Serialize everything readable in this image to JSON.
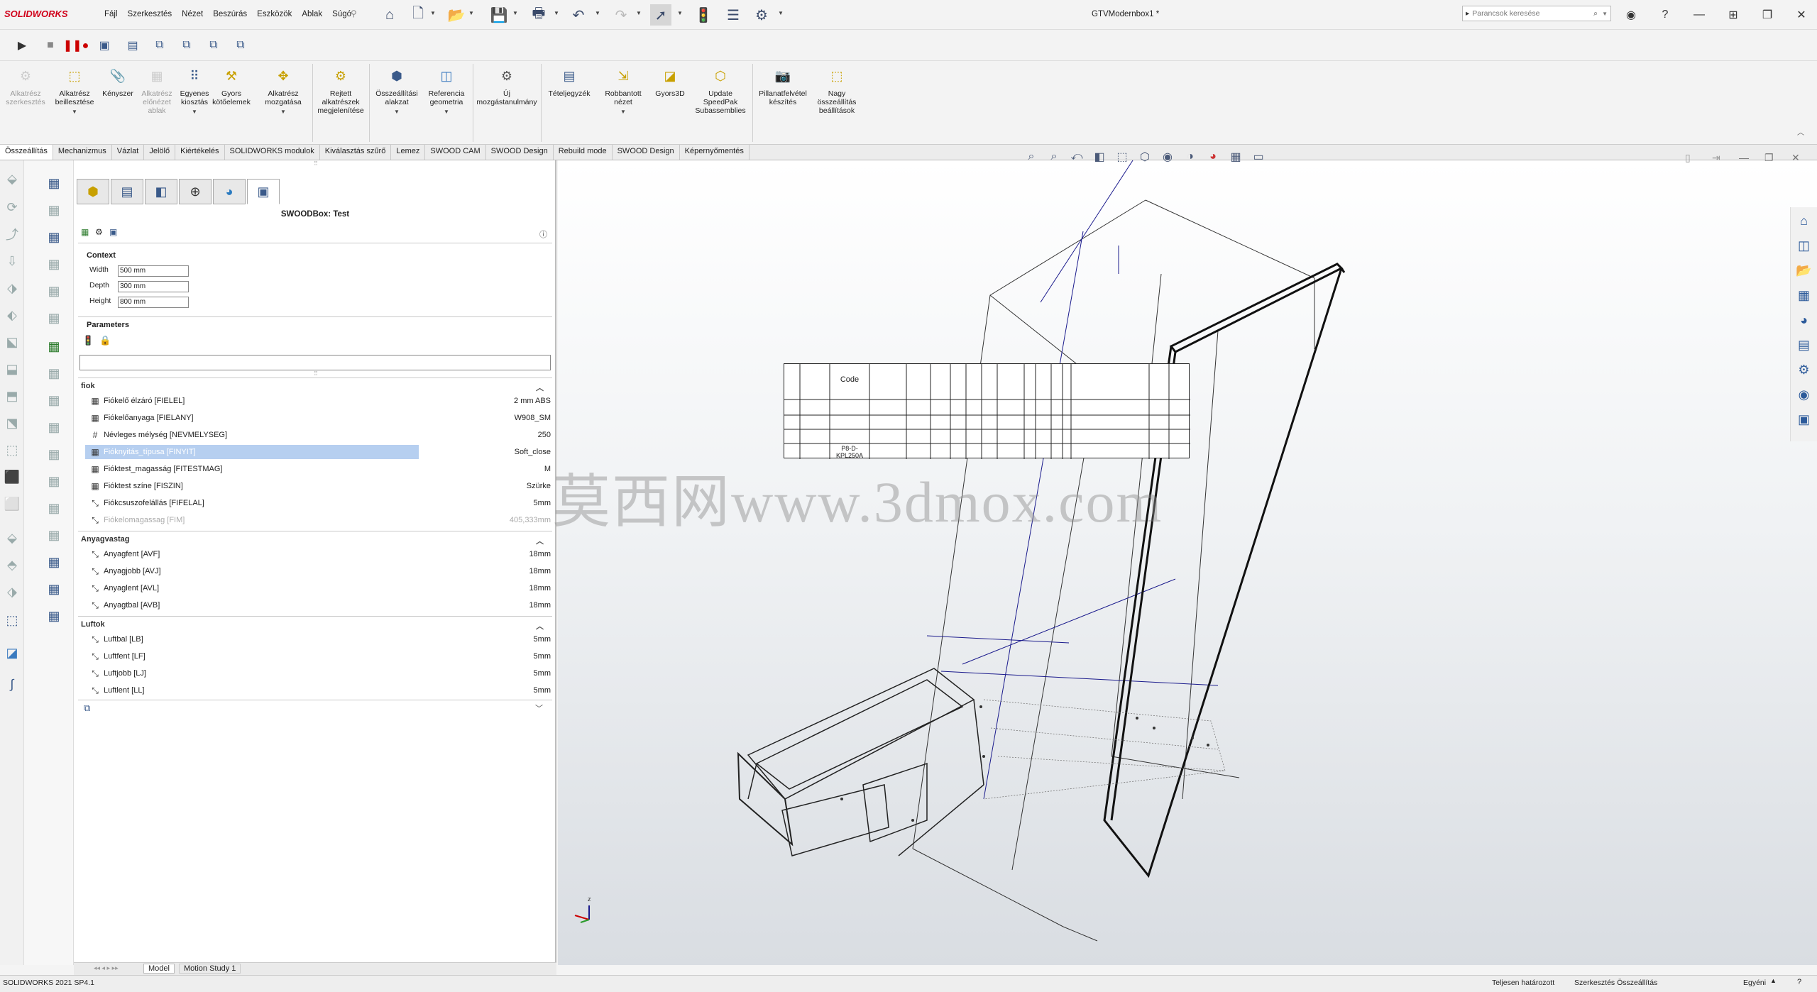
{
  "app": {
    "logo": "SOLIDWORKS",
    "document_title": "GTVModernbox1 *"
  },
  "menu": [
    "Fájl",
    "Szerkesztés",
    "Nézet",
    "Beszúrás",
    "Eszközök",
    "Ablak",
    "Súgó"
  ],
  "search": {
    "placeholder": "Parancsok keresése"
  },
  "commands": [
    {
      "label": "Alkatrész szerkesztés",
      "disabled": true
    },
    {
      "label": "Alkatrész beillesztése",
      "disabled": false
    },
    {
      "label": "Kényszer",
      "disabled": false
    },
    {
      "label": "Alkatrész előnézet ablak",
      "disabled": true
    },
    {
      "label": "Egyenes kiosztás",
      "disabled": false
    },
    {
      "label": "Gyors kötőelemek",
      "disabled": false
    },
    {
      "label": "Alkatrész mozgatása",
      "disabled": false
    },
    {
      "label": "Rejtett alkatrészek megjelenítése",
      "disabled": false
    },
    {
      "label": "Összeállítási alakzat",
      "disabled": false
    },
    {
      "label": "Referencia geometria",
      "disabled": false
    },
    {
      "label": "Új mozgástanulmány",
      "disabled": false
    },
    {
      "label": "Tételjegyzék",
      "disabled": false
    },
    {
      "label": "Robbantott nézet",
      "disabled": false
    },
    {
      "label": "Gyors3D",
      "disabled": false
    },
    {
      "label": "Update SpeedPak Subassemblies",
      "disabled": false
    },
    {
      "label": "Pillanatfelvétel készítés",
      "disabled": false
    },
    {
      "label": "Nagy összeállítás beállítások",
      "disabled": false
    }
  ],
  "tabs": [
    "Összeállítás",
    "Mechanizmus",
    "Vázlat",
    "Jelölő",
    "Kiértékelés",
    "SOLIDWORKS modulok",
    "Kiválasztás szűrő",
    "Lemez",
    "SWOOD CAM",
    "SWOOD Design",
    "Rebuild mode",
    "SWOOD Design",
    "Képernyőmentés"
  ],
  "panel": {
    "title": "SWOODBox: Test",
    "context_label": "Context",
    "fields": [
      {
        "label": "Width",
        "value": "500 mm"
      },
      {
        "label": "Depth",
        "value": "300 mm"
      },
      {
        "label": "Height",
        "value": "800 mm"
      }
    ],
    "parameters_label": "Parameters",
    "groups": [
      {
        "name": "fiok",
        "rows": [
          {
            "name": "Fiókelő élzáró [FIELEL]",
            "value": "2 mm ABS",
            "icon": "table"
          },
          {
            "name": "Fiókelőanyaga [FIELANY]",
            "value": "W908_SM",
            "icon": "table"
          },
          {
            "name": "Névleges mélység [NEVMELYSEG]",
            "value": "250",
            "icon": "hash"
          },
          {
            "name": "Fióknyitás_típusa [FINYIT]",
            "value": "Soft_close",
            "icon": "table",
            "selected": true
          },
          {
            "name": "Fióktest_magasság [FITESTMAG]",
            "value": "M",
            "icon": "table"
          },
          {
            "name": "Fióktest színe [FISZIN]",
            "value": "Szürke",
            "icon": "table"
          },
          {
            "name": "Fiókcsuszofelállás [FIFELAL]",
            "value": "5mm",
            "icon": "dim"
          },
          {
            "name": "Fiókelomagassag [FIM]",
            "value": "405,333mm",
            "icon": "dim",
            "dim": true
          }
        ]
      },
      {
        "name": "Anyagvastag",
        "rows": [
          {
            "name": "Anyagfent [AVF]",
            "value": "18mm",
            "icon": "dim"
          },
          {
            "name": "Anyagjobb [AVJ]",
            "value": "18mm",
            "icon": "dim"
          },
          {
            "name": "Anyaglent [AVL]",
            "value": "18mm",
            "icon": "dim"
          },
          {
            "name": "Anyagtbal [AVB]",
            "value": "18mm",
            "icon": "dim"
          }
        ]
      },
      {
        "name": "Luftok",
        "rows": [
          {
            "name": "Luftbal [LB]",
            "value": "5mm",
            "icon": "dim"
          },
          {
            "name": "Luftfent [LF]",
            "value": "5mm",
            "icon": "dim"
          },
          {
            "name": "Luftjobb [LJ]",
            "value": "5mm",
            "icon": "dim"
          },
          {
            "name": "Luftlent [LL]",
            "value": "5mm",
            "icon": "dim"
          }
        ]
      }
    ]
  },
  "bom": {
    "code_header": "Code",
    "last_row_text": "P8-D-KPL250A"
  },
  "watermark": "莫西网www.3dmox.com",
  "model_tabs": [
    "Model",
    "Motion Study 1"
  ],
  "status": {
    "version": "SOLIDWORKS 2021 SP4.1",
    "state": "Teljesen határozott",
    "mode": "Szerkesztés Összeállítás",
    "units": "Egyéni"
  },
  "colors": {
    "accent": "#d0021b",
    "selection": "#b6cff0",
    "sketch_blue": "#1a1a8c"
  }
}
